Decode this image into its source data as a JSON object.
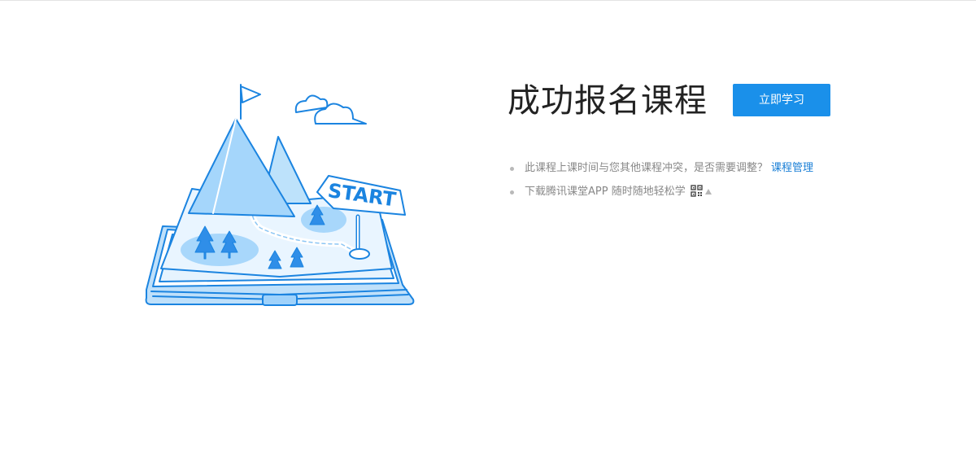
{
  "page": {
    "title": "成功报名课程",
    "study_button_label": "立即学习"
  },
  "illustration": {
    "sign_text": "START"
  },
  "tips": {
    "conflict_text": "此课程上课时间与您其他课程冲突，是否需要调整？",
    "manage_link_label": "课程管理",
    "download_text": "下载腾讯课堂APP 随时随地轻松学"
  },
  "icons": {
    "qr": "qr-code-icon",
    "caret": "caret-up-icon",
    "bullet": "bullet-icon"
  },
  "colors": {
    "accent": "#1a90ea",
    "link": "#1a7fd6",
    "illustration_line": "#1b84e0",
    "illustration_fill": "#cfe8fb"
  }
}
